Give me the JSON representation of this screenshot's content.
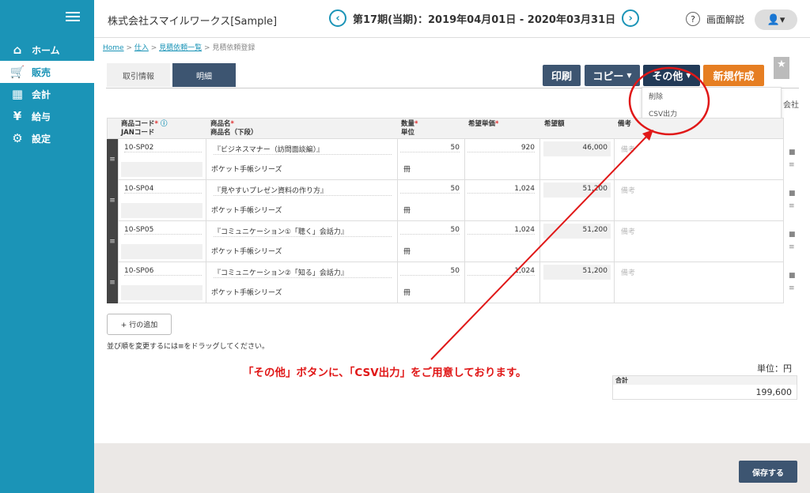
{
  "sidebar": {
    "items": [
      {
        "label": "ホーム",
        "icon": "home-icon"
      },
      {
        "label": "販売",
        "icon": "cart-icon",
        "active": true
      },
      {
        "label": "会計",
        "icon": "calculator-icon"
      },
      {
        "label": "給与",
        "icon": "money-bag-icon"
      },
      {
        "label": "設定",
        "icon": "gear-icon"
      }
    ]
  },
  "header": {
    "company": "株式会社スマイルワークス[Sample]",
    "period": "第17期(当期)：2019年04月01日 - 2020年03月31日",
    "help": "画面解説"
  },
  "breadcrumb": {
    "home": "Home",
    "purchase": "仕入",
    "list": "見積依頼一覧",
    "current": "見積依頼登録"
  },
  "tabs": {
    "info": "取引情報",
    "detail": "明細"
  },
  "toolbar": {
    "print": "印刷",
    "copy": "コピー",
    "other": "その他",
    "new": "新規作成"
  },
  "other_menu": {
    "delete": "削除",
    "csv": "CSV出力"
  },
  "partial_text": "会社",
  "table": {
    "headers": {
      "code": "商品コード",
      "jan": "JANコード",
      "name": "商品名",
      "name_lower": "商品名（下段）",
      "qty": "数量",
      "unit": "単位",
      "price": "希望単価",
      "amount": "希望額",
      "remarks": "備考"
    },
    "rows": [
      {
        "code": "10-SP02",
        "name": "『ビジネスマナー（訪問面談編）』",
        "name2": "ポケット手帳シリーズ",
        "qty": "50",
        "unit": "冊",
        "price": "920",
        "amount": "46,000",
        "remarks": "備考"
      },
      {
        "code": "10-SP04",
        "name": "『見やすいプレゼン資料の作り方』",
        "name2": "ポケット手帳シリーズ",
        "qty": "50",
        "unit": "冊",
        "price": "1,024",
        "amount": "51,200",
        "remarks": "備考"
      },
      {
        "code": "10-SP05",
        "name": "『コミュニケーション①「聴く」会話力』",
        "name2": "ポケット手帳シリーズ",
        "qty": "50",
        "unit": "冊",
        "price": "1,024",
        "amount": "51,200",
        "remarks": "備考"
      },
      {
        "code": "10-SP06",
        "name": "『コミュニケーション②「知る」会話力』",
        "name2": "ポケット手帳シリーズ",
        "qty": "50",
        "unit": "冊",
        "price": "1,024",
        "amount": "51,200",
        "remarks": "備考"
      }
    ]
  },
  "add_row": "+ 行の追加",
  "drag_note": "並び順を変更するには≡をドラッグしてください。",
  "annotation": "「その他」ボタンに、「CSV出力」をご用意しております。",
  "unit_label": "単位：円",
  "total": {
    "label": "合計",
    "value": "199,600"
  },
  "save": "保存する",
  "colors": {
    "sidebar": "#1b94b7",
    "button": "#3d5571",
    "new": "#e67e22",
    "annotation": "#e01818"
  }
}
